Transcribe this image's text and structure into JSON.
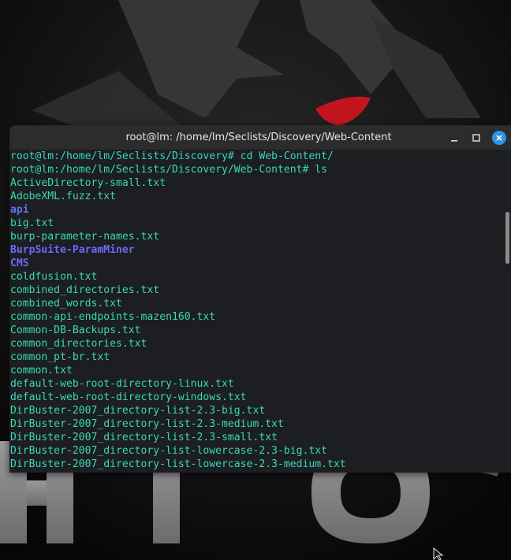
{
  "window": {
    "title": "root@lm: /home/lm/Seclists/Discovery/Web-Content"
  },
  "colors": {
    "prompt_text": "#3ad9b4",
    "directory_text": "#6a6aff",
    "close_button": "#2f93e8",
    "wolf_eye": "#c3151e"
  },
  "icons": {
    "minimize": "minimize-icon",
    "maximize": "maximize-icon",
    "close": "close-icon",
    "cursor": "mouse-pointer-icon"
  },
  "terminal": {
    "lines": [
      {
        "text": "root@lm:/home/lm/Seclists/Discovery# cd Web-Content/",
        "kind": "prompt"
      },
      {
        "text": "root@lm:/home/lm/Seclists/Discovery/Web-Content# ls",
        "kind": "prompt"
      },
      {
        "text": "ActiveDirectory-small.txt",
        "kind": "file"
      },
      {
        "text": "AdobeXML.fuzz.txt",
        "kind": "file"
      },
      {
        "text": "api",
        "kind": "dir"
      },
      {
        "text": "big.txt",
        "kind": "file"
      },
      {
        "text": "burp-parameter-names.txt",
        "kind": "file"
      },
      {
        "text": "BurpSuite-ParamMiner",
        "kind": "dir"
      },
      {
        "text": "CMS",
        "kind": "dir"
      },
      {
        "text": "coldfusion.txt",
        "kind": "file"
      },
      {
        "text": "combined_directories.txt",
        "kind": "file"
      },
      {
        "text": "combined_words.txt",
        "kind": "file"
      },
      {
        "text": "common-api-endpoints-mazen160.txt",
        "kind": "file"
      },
      {
        "text": "Common-DB-Backups.txt",
        "kind": "file"
      },
      {
        "text": "common_directories.txt",
        "kind": "file"
      },
      {
        "text": "common_pt-br.txt",
        "kind": "file"
      },
      {
        "text": "common.txt",
        "kind": "file"
      },
      {
        "text": "default-web-root-directory-linux.txt",
        "kind": "file"
      },
      {
        "text": "default-web-root-directory-windows.txt",
        "kind": "file"
      },
      {
        "text": "DirBuster-2007_directory-list-2.3-big.txt",
        "kind": "file"
      },
      {
        "text": "DirBuster-2007_directory-list-2.3-medium.txt",
        "kind": "file"
      },
      {
        "text": "DirBuster-2007_directory-list-2.3-small.txt",
        "kind": "file"
      },
      {
        "text": "DirBuster-2007_directory-list-lowercase-2.3-big.txt",
        "kind": "file"
      },
      {
        "text": "DirBuster-2007_directory-list-lowercase-2.3-medium.txt",
        "kind": "file"
      }
    ]
  }
}
